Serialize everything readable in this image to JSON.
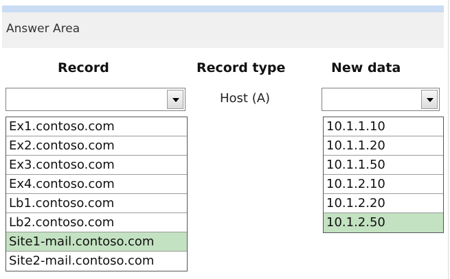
{
  "header": {
    "title": "Answer Area"
  },
  "columns": {
    "record": "Record",
    "record_type": "Record type",
    "new_data": "New data"
  },
  "record_type_value": "Host (A)",
  "record_select": {
    "value": "",
    "options": [
      {
        "label": "Ex1.contoso.com",
        "selected": false
      },
      {
        "label": "Ex2.contoso.com",
        "selected": false
      },
      {
        "label": "Ex3.contoso.com",
        "selected": false
      },
      {
        "label": "Ex4.contoso.com",
        "selected": false
      },
      {
        "label": "Lb1.contoso.com",
        "selected": false
      },
      {
        "label": "Lb2.contoso.com",
        "selected": false
      },
      {
        "label": "Site1-mail.contoso.com",
        "selected": true
      },
      {
        "label": "Site2-mail.contoso.com",
        "selected": false
      }
    ]
  },
  "new_data_select": {
    "value": "",
    "options": [
      {
        "label": "10.1.1.10",
        "selected": false
      },
      {
        "label": "10.1.1.20",
        "selected": false
      },
      {
        "label": "10.1.1.50",
        "selected": false
      },
      {
        "label": "10.1.2.10",
        "selected": false
      },
      {
        "label": "10.1.2.20",
        "selected": false
      },
      {
        "label": "10.1.2.50",
        "selected": true
      }
    ]
  },
  "colors": {
    "selected_highlight": "#c3e2c1",
    "top_bar": "#c9dcf3",
    "header_bg": "#f0f0f0"
  },
  "icons": {
    "dropdown": "chevron-down-icon"
  }
}
